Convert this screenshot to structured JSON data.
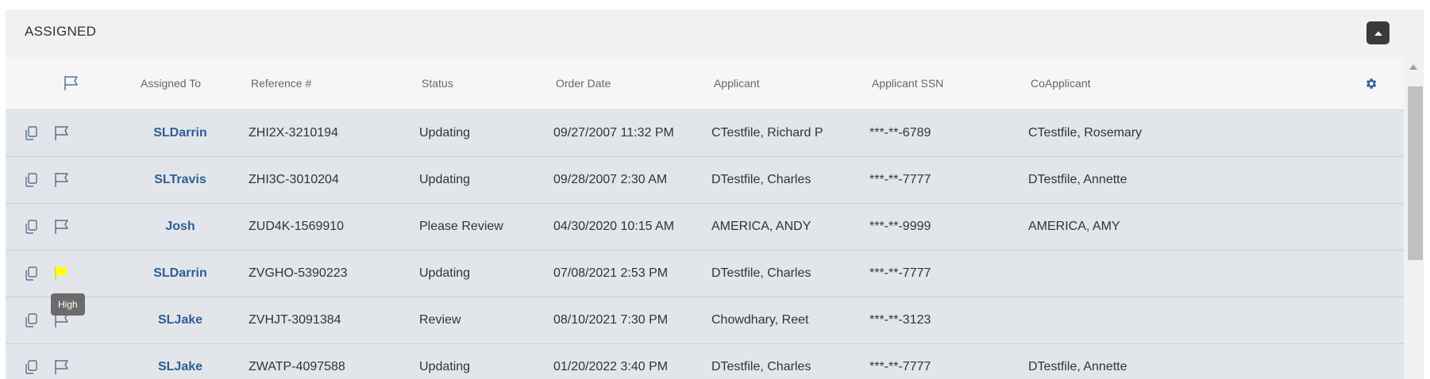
{
  "panel": {
    "title": "ASSIGNED",
    "collapse_icon": "caret-up-icon"
  },
  "table": {
    "columns": {
      "assigned_to": "Assigned To",
      "reference": "Reference #",
      "status": "Status",
      "order_date": "Order Date",
      "applicant": "Applicant",
      "applicant_ssn": "Applicant SSN",
      "coapplicant": "CoApplicant"
    },
    "header_icons": [
      "flag-icon",
      "gear-icon"
    ],
    "rows": [
      {
        "flag": "none",
        "assigned_to": "SLDarrin",
        "reference": "ZHI2X-3210194",
        "status": "Updating",
        "order_date": "09/27/2007 11:32 PM",
        "applicant": "CTestfile, Richard P",
        "applicant_ssn": "***-**-6789",
        "coapplicant": "CTestfile, Rosemary"
      },
      {
        "flag": "none",
        "assigned_to": "SLTravis",
        "reference": "ZHI3C-3010204",
        "status": "Updating",
        "order_date": "09/28/2007 2:30 AM",
        "applicant": "DTestfile, Charles",
        "applicant_ssn": "***-**-7777",
        "coapplicant": "DTestfile, Annette"
      },
      {
        "flag": "none",
        "assigned_to": "Josh",
        "reference": "ZUD4K-1569910",
        "status": "Please Review",
        "order_date": "04/30/2020 10:15 AM",
        "applicant": "AMERICA, ANDY",
        "applicant_ssn": "***-**-9999",
        "coapplicant": "AMERICA, AMY"
      },
      {
        "flag": "high",
        "assigned_to": "SLDarrin",
        "reference": "ZVGHO-5390223",
        "status": "Updating",
        "order_date": "07/08/2021 2:53 PM",
        "applicant": "DTestfile, Charles",
        "applicant_ssn": "***-**-7777",
        "coapplicant": ""
      },
      {
        "flag": "none",
        "assigned_to": "SLJake",
        "reference": "ZVHJT-3091384",
        "status": "Review",
        "order_date": "08/10/2021 7:30 PM",
        "applicant": "Chowdhary, Reet",
        "applicant_ssn": "***-**-3123",
        "coapplicant": ""
      },
      {
        "flag": "none",
        "assigned_to": "SLJake",
        "reference": "ZWATP-4097588",
        "status": "Updating",
        "order_date": "01/20/2022 3:40 PM",
        "applicant": "DTestfile, Charles",
        "applicant_ssn": "***-**-7777",
        "coapplicant": "DTestfile, Annette"
      }
    ]
  },
  "tooltip": {
    "text": "High"
  },
  "colors": {
    "link": "#2f5d96",
    "flag_high": "#ffff00",
    "row_bg": "#e2e6eb",
    "gear": "#2f5d96"
  }
}
